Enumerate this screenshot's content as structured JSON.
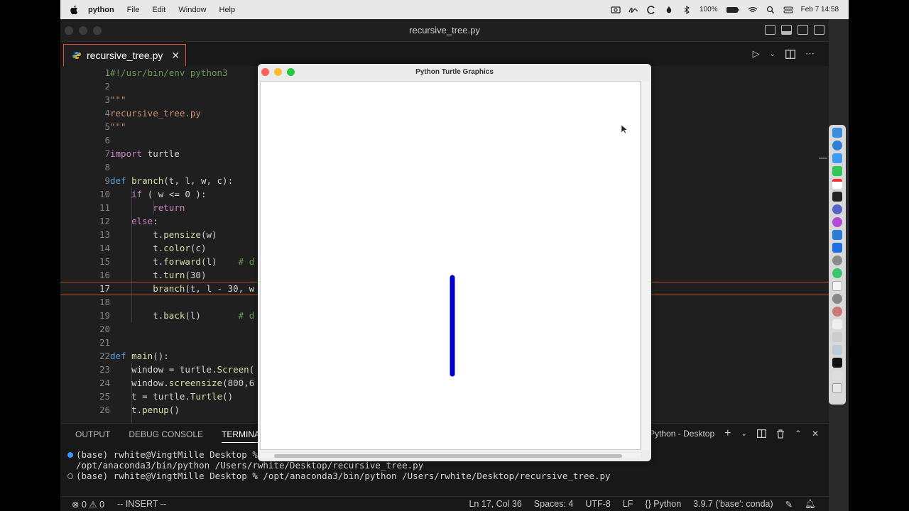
{
  "menubar": {
    "app": "python",
    "items": [
      "File",
      "Edit",
      "Window",
      "Help"
    ],
    "battery": "100%",
    "datetime": "Feb 7  14:58"
  },
  "window": {
    "title": "recursive_tree.py"
  },
  "tab": {
    "label": "recursive_tree.py"
  },
  "code": {
    "lines": [
      "1",
      "2",
      "3",
      "4",
      "5",
      "6",
      "7",
      "8",
      "9",
      "10",
      "11",
      "12",
      "13",
      "14",
      "15",
      "16",
      "17",
      "18",
      "19",
      "20",
      "21",
      "22",
      "23",
      "24",
      "25",
      "26"
    ],
    "active_line": "17"
  },
  "panel": {
    "tabs": [
      "OUTPUT",
      "DEBUG CONSOLE",
      "TERMINAL"
    ],
    "terminal_name": "Python - Desktop",
    "terminal_lines": [
      "(base) rwhite@VingtMille Desktop % ",
      "/opt/anaconda3/bin/python /Users/rwhite/Desktop/recursive_tree.py",
      "(base) rwhite@VingtMille Desktop % /opt/anaconda3/bin/python /Users/rwhite/Desktop/recursive_tree.py"
    ]
  },
  "status": {
    "errors": "0",
    "warnings": "0",
    "mode": "-- INSERT --",
    "position": "Ln 17, Col 36",
    "spaces": "Spaces: 4",
    "encoding": "UTF-8",
    "eol": "LF",
    "language": "Python",
    "interpreter": "3.9.7 ('base': conda)"
  },
  "turtle": {
    "title": "Python Turtle Graphics",
    "pen_color": "#0000cc"
  }
}
